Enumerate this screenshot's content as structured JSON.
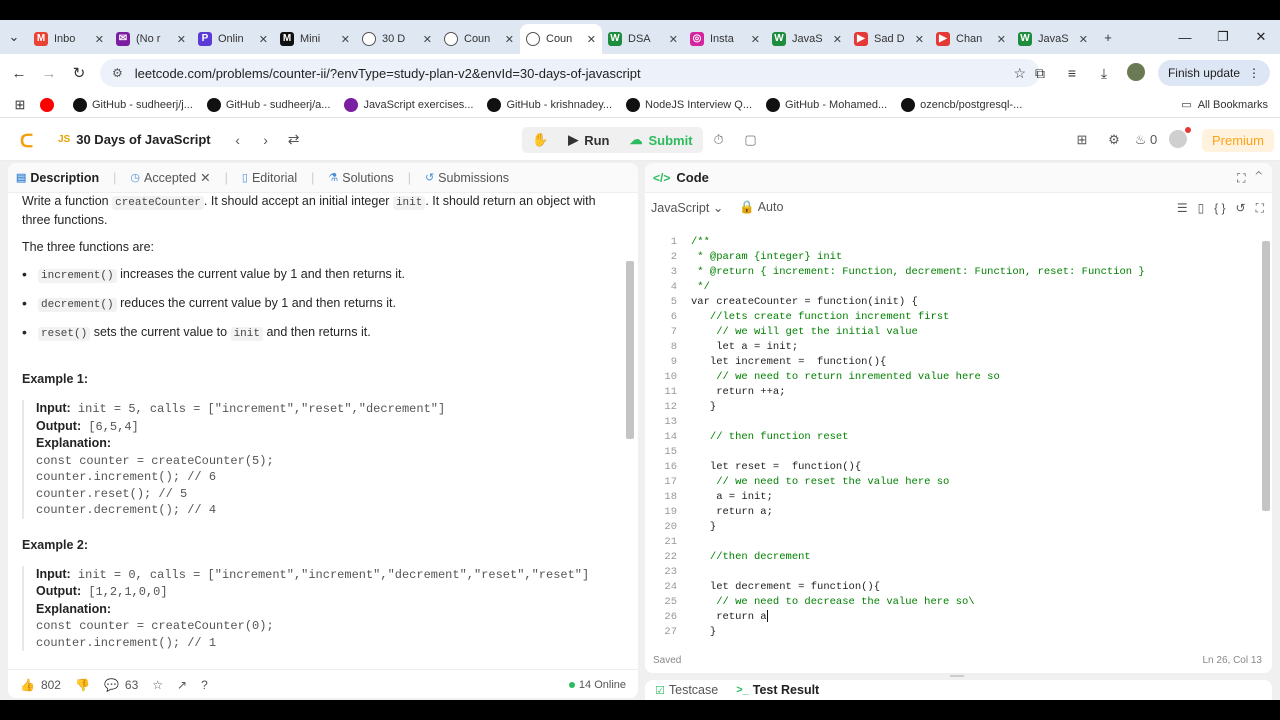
{
  "browser": {
    "tabs": [
      {
        "label": "Inbo",
        "color": "#ea4335",
        "glyph": "M",
        "active": false
      },
      {
        "label": "(No r",
        "color": "#7b1fa2",
        "glyph": "✉",
        "active": false
      },
      {
        "label": "Onlin",
        "color": "#5b3bd6",
        "glyph": "P",
        "active": false
      },
      {
        "label": "Mini",
        "color": "#111111",
        "glyph": "M",
        "active": false
      },
      {
        "label": "30 D",
        "color": "#ffffff",
        "glyph": "",
        "active": false
      },
      {
        "label": "Coun",
        "color": "#ffffff",
        "glyph": "",
        "active": false
      },
      {
        "label": "Coun",
        "color": "#ffffff",
        "glyph": "",
        "active": true
      },
      {
        "label": "DSA",
        "color": "#1e8e3e",
        "glyph": "W",
        "active": false
      },
      {
        "label": "Insta",
        "color": "#d6249f",
        "glyph": "◎",
        "active": false
      },
      {
        "label": "JavaS",
        "color": "#1e8e3e",
        "glyph": "W",
        "active": false
      },
      {
        "label": "Sad D",
        "color": "#e53935",
        "glyph": "▶",
        "active": false
      },
      {
        "label": "Chan",
        "color": "#e53935",
        "glyph": "▶",
        "active": false
      },
      {
        "label": "JavaS",
        "color": "#1e8e3e",
        "glyph": "W",
        "active": false
      }
    ],
    "url": "leetcode.com/problems/counter-ii/?envType=study-plan-v2&envId=30-days-of-javascript",
    "finish_update": "Finish update",
    "bookmarks": [
      {
        "label": "",
        "color": "#ff0000"
      },
      {
        "label": "GitHub - sudheerj/j...",
        "color": "#111111"
      },
      {
        "label": "GitHub - sudheerj/a...",
        "color": "#111111"
      },
      {
        "label": "JavaScript exercises...",
        "color": "#7b1fa2"
      },
      {
        "label": "GitHub - krishnadey...",
        "color": "#111111"
      },
      {
        "label": "NodeJS Interview Q...",
        "color": "#111111"
      },
      {
        "label": "GitHub - Mohamed...",
        "color": "#111111"
      },
      {
        "label": "ozencb/postgresql-...",
        "color": "#111111"
      }
    ],
    "all_bookmarks": "All Bookmarks"
  },
  "lc": {
    "js_badge": "JS",
    "plan_title": "30 Days of JavaScript",
    "run": "Run",
    "submit": "Submit",
    "streak": "0",
    "premium": "Premium"
  },
  "left": {
    "tabs": [
      {
        "label": "Description",
        "icon": "▤"
      },
      {
        "label": "Accepted",
        "icon": "◷"
      },
      {
        "label": "Editorial",
        "icon": "▯"
      },
      {
        "label": "Solutions",
        "icon": "⚗"
      },
      {
        "label": "Submissions",
        "icon": "↺"
      }
    ],
    "intro_a": "Write a function ",
    "intro_code1": "createCounter",
    "intro_b": ". It should accept an initial integer ",
    "intro_code2": "init",
    "intro_c": ". It should return an object with three functions.",
    "three": "The three functions are:",
    "bullets": [
      {
        "code": "increment()",
        "text": " increases the current value by 1 and then returns it."
      },
      {
        "code": "decrement()",
        "text": " reduces the current value by 1 and then returns it."
      },
      {
        "code": "reset()",
        "text": " sets the current value to ",
        "code2": "init",
        "text2": " and then returns it."
      }
    ],
    "ex1_title": "Example 1:",
    "ex1": {
      "input_label": "Input:",
      "input": " init = 5, calls = [\"increment\",\"reset\",\"decrement\"]",
      "output_label": "Output:",
      "output": " [6,5,4]",
      "expl_label": "Explanation:",
      "lines": [
        "const counter = createCounter(5);",
        "counter.increment(); // 6",
        "counter.reset(); // 5",
        "counter.decrement(); // 4"
      ]
    },
    "ex2_title": "Example 2:",
    "ex2": {
      "input_label": "Input:",
      "input": " init = 0, calls = [\"increment\",\"increment\",\"decrement\",\"reset\",\"reset\"]",
      "output_label": "Output:",
      "output": " [1,2,1,0,0]",
      "expl_label": "Explanation:",
      "lines": [
        "const counter = createCounter(0);",
        "counter.increment(); // 1"
      ]
    },
    "likes": "802",
    "comments": "63",
    "online": "14 Online"
  },
  "right": {
    "title": "Code",
    "language": "JavaScript",
    "auto": "Auto",
    "code_lines": [
      {
        "n": "1",
        "t": "/**",
        "c": "cm"
      },
      {
        "n": "2",
        "t": " * @param {integer} init",
        "c": "cm"
      },
      {
        "n": "3",
        "t": " * @return { increment: Function, decrement: Function, reset: Function }",
        "c": "cm"
      },
      {
        "n": "4",
        "t": " */",
        "c": "cm"
      },
      {
        "n": "5",
        "t": "var createCounter = function(init) {",
        "c": ""
      },
      {
        "n": "6",
        "t": "   //lets create function increment first",
        "c": "cm"
      },
      {
        "n": "7",
        "t": "    // we will get the initial value",
        "c": "cm"
      },
      {
        "n": "8",
        "t": "    let a = init;",
        "c": ""
      },
      {
        "n": "9",
        "t": "   let increment =  function(){",
        "c": ""
      },
      {
        "n": "10",
        "t": "    // we need to return inremented value here so",
        "c": "cm"
      },
      {
        "n": "11",
        "t": "    return ++a;",
        "c": ""
      },
      {
        "n": "12",
        "t": "   }",
        "c": ""
      },
      {
        "n": "13",
        "t": "",
        "c": ""
      },
      {
        "n": "14",
        "t": "   // then function reset",
        "c": "cm"
      },
      {
        "n": "15",
        "t": "",
        "c": ""
      },
      {
        "n": "16",
        "t": "   let reset =  function(){",
        "c": ""
      },
      {
        "n": "17",
        "t": "    // we need to reset the value here so",
        "c": "cm"
      },
      {
        "n": "18",
        "t": "    a = init;",
        "c": ""
      },
      {
        "n": "19",
        "t": "    return a;",
        "c": ""
      },
      {
        "n": "20",
        "t": "   }",
        "c": ""
      },
      {
        "n": "21",
        "t": "",
        "c": ""
      },
      {
        "n": "22",
        "t": "   //then decrement",
        "c": "cm"
      },
      {
        "n": "23",
        "t": "",
        "c": ""
      },
      {
        "n": "24",
        "t": "   let decrement = function(){",
        "c": ""
      },
      {
        "n": "25",
        "t": "    // we need to decrease the value here so\\",
        "c": "cm"
      },
      {
        "n": "26",
        "t": "    return a",
        "c": "",
        "cursor": true
      },
      {
        "n": "27",
        "t": "   }",
        "c": ""
      }
    ],
    "saved": "Saved",
    "position": "Ln 26, Col 13"
  },
  "bottom": {
    "testcase": "Testcase",
    "test_result": "Test Result"
  }
}
